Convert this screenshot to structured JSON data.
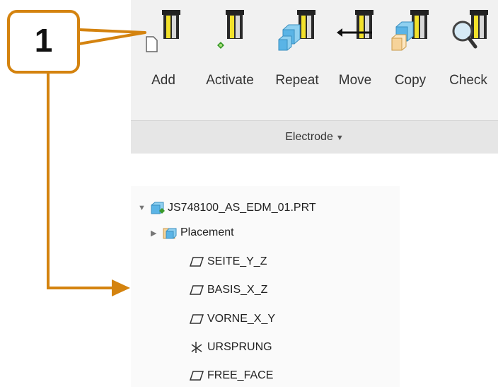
{
  "callout": {
    "number": "1"
  },
  "ribbon": {
    "tools": [
      {
        "label": "Add",
        "icon": "electrode-add-icon"
      },
      {
        "label": "Activate",
        "icon": "electrode-activate-icon"
      },
      {
        "label": "Repeat",
        "icon": "electrode-repeat-icon"
      },
      {
        "label": "Move",
        "icon": "electrode-move-icon"
      },
      {
        "label": "Copy",
        "icon": "electrode-copy-icon"
      },
      {
        "label": "Check",
        "icon": "electrode-check-icon"
      }
    ],
    "group_label": "Electrode",
    "group_caret": "▼"
  },
  "tree": {
    "root": {
      "label": "JS748100_AS_EDM_01.PRT",
      "toggle": "▼",
      "icon": "part-icon"
    },
    "items": [
      {
        "label": "Placement",
        "toggle": "▶",
        "icon": "placement-feature-icon"
      },
      {
        "label": "SEITE_Y_Z",
        "icon": "datum-plane-icon"
      },
      {
        "label": "BASIS_X_Z",
        "icon": "datum-plane-icon"
      },
      {
        "label": "VORNE_X_Y",
        "icon": "datum-plane-icon"
      },
      {
        "label": "URSPRUNG",
        "icon": "coordinate-system-icon"
      },
      {
        "label": "FREE_FACE",
        "icon": "datum-plane-icon"
      }
    ]
  },
  "colors": {
    "callout_orange": "#d4830f",
    "electrode_yellow": "#f2e12b",
    "cube_blue": "#5ab4e6"
  }
}
